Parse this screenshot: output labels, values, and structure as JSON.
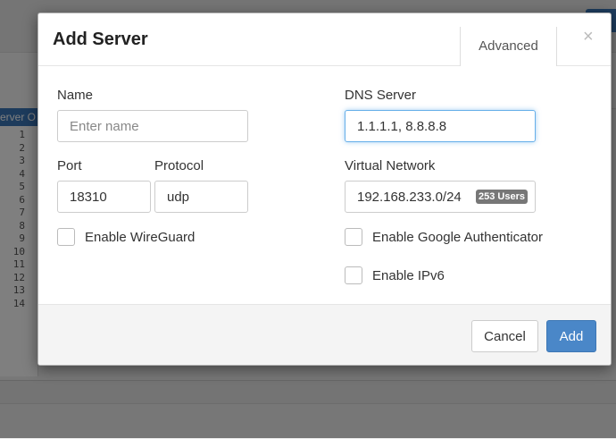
{
  "background": {
    "tab_label": "erver O",
    "line_numbers": [
      "1",
      "2",
      "3",
      "4",
      "5",
      "6",
      "7",
      "8",
      "9",
      "10",
      "11",
      "12",
      "13",
      "14"
    ]
  },
  "modal": {
    "title": "Add Server",
    "advanced_tab": "Advanced",
    "close_symbol": "×",
    "name": {
      "label": "Name",
      "value": "",
      "placeholder": "Enter name"
    },
    "dns": {
      "label": "DNS Server",
      "value": "1.1.1.1, 8.8.8.8"
    },
    "port": {
      "label": "Port",
      "value": "18310"
    },
    "protocol": {
      "label": "Protocol",
      "value": "udp"
    },
    "virtual_network": {
      "label": "Virtual Network",
      "value": "192.168.233.0/24",
      "badge": "253 Users"
    },
    "checkboxes": {
      "wireguard": {
        "label": "Enable WireGuard",
        "checked": false
      },
      "google_auth": {
        "label": "Enable Google Authenticator",
        "checked": false
      },
      "ipv6": {
        "label": "Enable IPv6",
        "checked": false
      }
    },
    "buttons": {
      "cancel": "Cancel",
      "add": "Add"
    }
  },
  "colors": {
    "primary": "#4a87c8",
    "focus": "#66afe9",
    "badge": "#777777"
  }
}
